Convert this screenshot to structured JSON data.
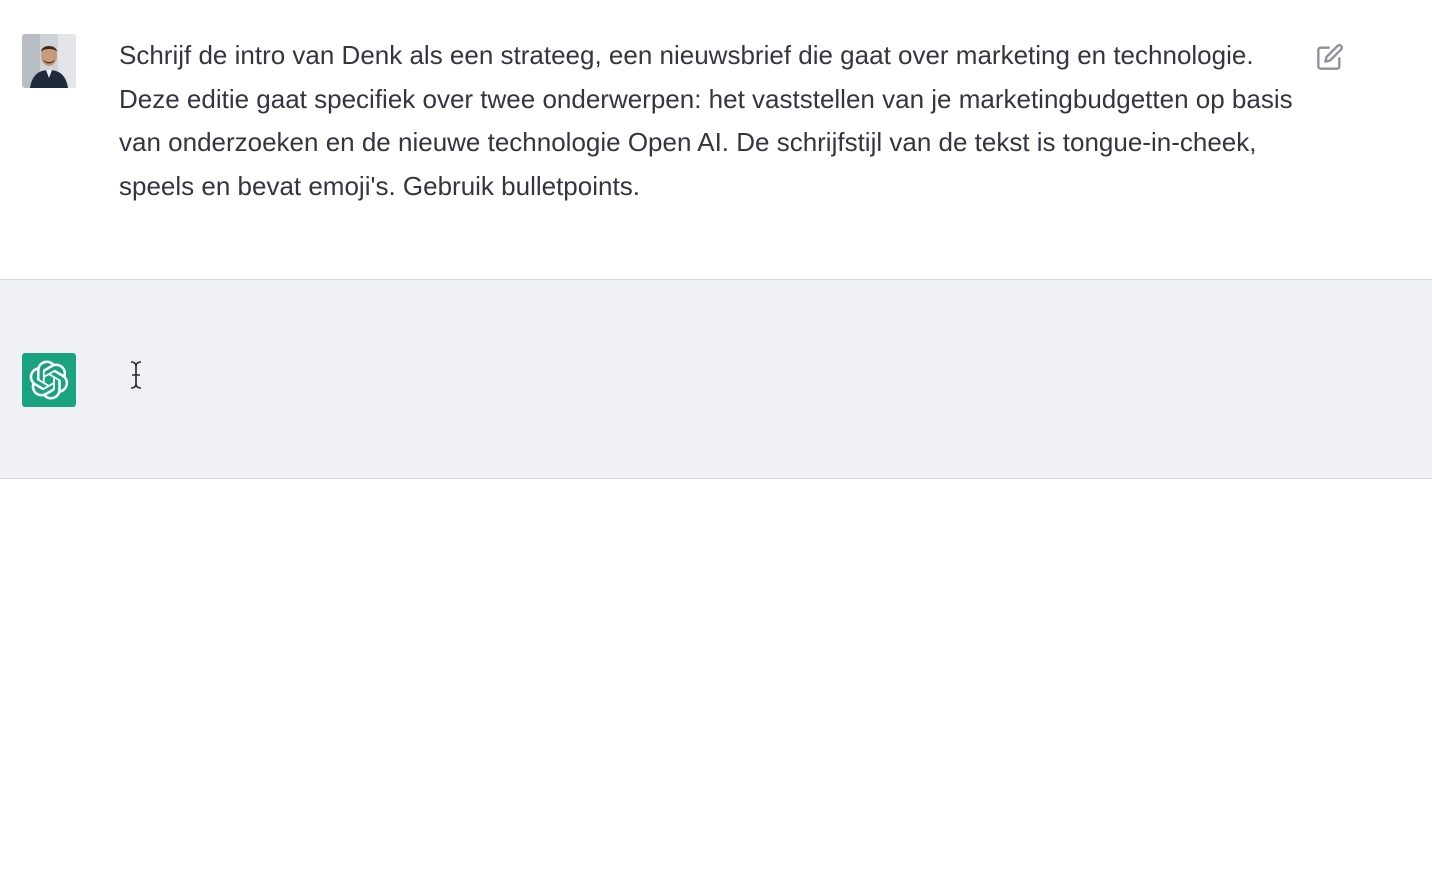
{
  "user_message": {
    "author": "user",
    "text": "Schrijf de intro van Denk als een strateeg, een nieuwsbrief die gaat over marketing en technologie. Deze editie gaat specifiek over twee onderwerpen: het vaststellen van je marketingbudgetten op basis van onderzoeken en de nieuwe technologie Open AI. De schrijfstijl van de tekst is tongue-in-cheek, speels en bevat emoji's. Gebruik bulletpoints.",
    "avatar_icon": "user-photo-avatar",
    "edit_icon": "edit-pencil-icon"
  },
  "assistant_message": {
    "author": "assistant",
    "text": "",
    "avatar_icon": "openai-logo-icon",
    "avatar_color": "#19a37f"
  },
  "colors": {
    "user_row_bg": "#ffffff",
    "assistant_row_bg": "#f0f1f4",
    "text": "#343541",
    "divider": "#d9d9e3",
    "icon_gray": "#8e8ea0"
  }
}
